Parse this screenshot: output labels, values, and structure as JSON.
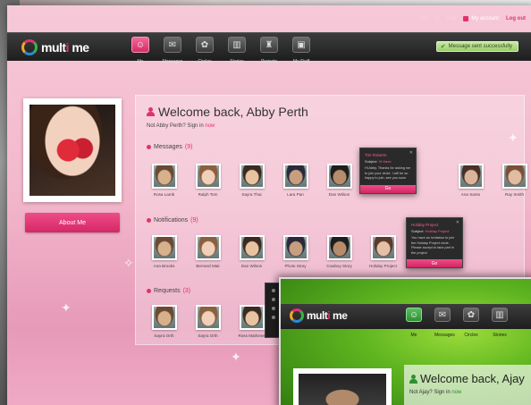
{
  "pink_window": {
    "util": {
      "lang": "En",
      "lang2": "Fr",
      "lang3": "Esp",
      "account": "My account",
      "logout": "Log out"
    },
    "brand": {
      "prefix": "mult",
      "accent": "i",
      "suffix": " me"
    },
    "nav": [
      {
        "label": "Me",
        "icon": "pig-icon",
        "glyph": "☺",
        "active": true
      },
      {
        "label": "Messages",
        "icon": "envelope-icon",
        "glyph": "✉",
        "active": false
      },
      {
        "label": "Circles",
        "icon": "circles-icon",
        "glyph": "✿",
        "active": false
      },
      {
        "label": "Stories",
        "icon": "book-icon",
        "glyph": "▥",
        "active": false
      },
      {
        "label": "Projects",
        "icon": "easel-icon",
        "glyph": "♜",
        "active": false
      },
      {
        "label": "My Stuff",
        "icon": "box-icon",
        "glyph": "▣",
        "active": false
      }
    ],
    "toast": "Message sent successfully",
    "about_button": "About Me",
    "welcome": "Welcome back, Abby Perth",
    "not_prefix": "Not Abby Perth? Sign in ",
    "not_link": "now",
    "messages": {
      "title": "Messages",
      "count": "(9)",
      "people": [
        "Rosa Lamb",
        "Ralph Tom",
        "Sayra Thai",
        "Lara Pan",
        "Dan Wilson",
        "",
        "",
        "Ana Santo",
        "Ray Smith"
      ]
    },
    "notifications": {
      "title": "Notifications",
      "count": "(9)",
      "people": [
        "Ana Brooks",
        "Bernard Mak",
        "Dan Wilson",
        "Photo Story",
        "Cowboy Story",
        "Holiday Project"
      ]
    },
    "requests": {
      "title": "Requests",
      "count": "(3)",
      "people": [
        "Sayra Orth",
        "Sayra Orth",
        "Ross Mathews"
      ]
    },
    "popup_message": {
      "title": "Tim Roberts",
      "subject_label": "Subject: ",
      "subject": "Hi there",
      "body": "Hi Abby, Thanks for asking me to join your circle. I will be so happy to join, see you soon",
      "go": "Go"
    },
    "popup_notification": {
      "title": "Holiday Project",
      "subject_label": "Subject: ",
      "subject": "Holiday Project",
      "body": "You have an invitation to join the Holiday Project circle. Please accept to take part in the project",
      "go": "Go"
    }
  },
  "green_window": {
    "nav": [
      {
        "label": "Me",
        "icon": "face-icon",
        "glyph": "☺",
        "active": true
      },
      {
        "label": "Messages",
        "icon": "envelope-icon",
        "glyph": "✉",
        "active": false
      },
      {
        "label": "Circles",
        "icon": "circles-icon",
        "glyph": "✿",
        "active": false
      },
      {
        "label": "Stories",
        "icon": "book-icon",
        "glyph": "▥",
        "active": false
      }
    ],
    "welcome": "Welcome back, Ajay",
    "not_prefix": "Not Ajay? Sign in ",
    "not_link": "now"
  },
  "colors": {
    "accent_pink": "#e0326f",
    "accent_green": "#2f8e35",
    "toast_green": "#9ccc6c"
  }
}
